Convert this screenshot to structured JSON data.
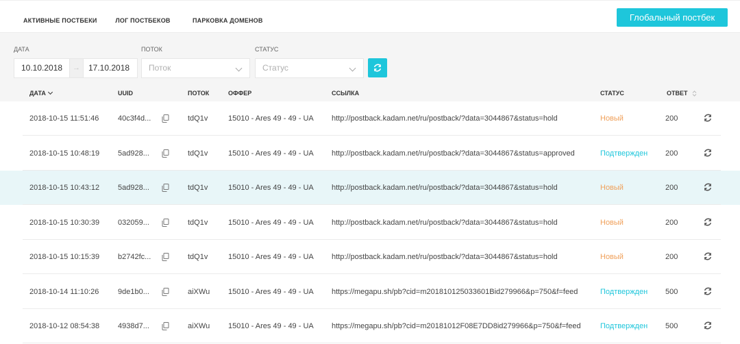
{
  "tabs": [
    {
      "label": "АКТИВНЫЕ ПОСТБЕКИ"
    },
    {
      "label": "ЛОГ ПОСТБЕКОВ"
    },
    {
      "label": "ПАРКОВКА ДОМЕНОВ"
    }
  ],
  "global_button": "Глобальный постбек",
  "filters": {
    "date_label": "ДАТА",
    "date_from": "10.10.2018",
    "date_to": "17.10.2018",
    "date_arrow": "→",
    "flow_label": "ПОТОК",
    "flow_placeholder": "Поток",
    "status_label": "СТАТУС",
    "status_placeholder": "Статус"
  },
  "table": {
    "headers": {
      "date": "ДАТА",
      "uuid": "UUID",
      "flow": "ПОТОК",
      "offer": "ОФФЕР",
      "link": "ССЫЛКА",
      "status": "СТАТУС",
      "answer": "ОТВЕТ"
    },
    "rows": [
      {
        "date": "2018-10-15 11:51:46",
        "uuid": "40c3f4d...",
        "flow": "tdQ1v",
        "offer": "15010 - Ares 49 - 49 - UA",
        "link": "http://postback.kadam.net/ru/postback/?data=3044867&status=hold",
        "status": "Новый",
        "answer": "200"
      },
      {
        "date": "2018-10-15 10:48:19",
        "uuid": "5ad928...",
        "flow": "tdQ1v",
        "offer": "15010 - Ares 49 - 49 - UA",
        "link": "http://postback.kadam.net/ru/postback/?data=3044867&status=approved",
        "status": "Подтвержден",
        "answer": "200"
      },
      {
        "date": "2018-10-15 10:43:12",
        "uuid": "5ad928...",
        "flow": "tdQ1v",
        "offer": "15010 - Ares 49 - 49 - UA",
        "link": "http://postback.kadam.net/ru/postback/?data=3044867&status=hold",
        "status": "Новый",
        "answer": "200"
      },
      {
        "date": "2018-10-15 10:30:39",
        "uuid": "032059...",
        "flow": "tdQ1v",
        "offer": "15010 - Ares 49 - 49 - UA",
        "link": "http://postback.kadam.net/ru/postback/?data=3044867&status=hold",
        "status": "Новый",
        "answer": "200"
      },
      {
        "date": "2018-10-15 10:15:39",
        "uuid": "b2742fc...",
        "flow": "tdQ1v",
        "offer": "15010 - Ares 49 - 49 - UA",
        "link": "http://postback.kadam.net/ru/postback/?data=3044867&status=hold",
        "status": "Новый",
        "answer": "200"
      },
      {
        "date": "2018-10-14 11:10:26",
        "uuid": "9de1b0...",
        "flow": "aiXWu",
        "offer": "15010 - Ares 49 - 49 - UA",
        "link": "https://megapu.sh/pb?cid=m201810125033601Bid279966&p=750&f=feed",
        "status": "Подтвержден",
        "answer": "500"
      },
      {
        "date": "2018-10-12 08:54:38",
        "uuid": "4938d7...",
        "flow": "aiXWu",
        "offer": "15010 - Ares 49 - 49 - UA",
        "link": "https://megapu.sh/pb?cid=m20181012F08E7DD8id279966&p=750&f=feed",
        "status": "Подтвержден",
        "answer": "500"
      }
    ]
  },
  "colors": {
    "accent": "#1ec6db",
    "tab_underline": "#e0574f",
    "status_new": "#f0a05a",
    "status_approved": "#1ec6db",
    "highlight_row": "#e8f6f8"
  },
  "icons": {
    "copy": "copy-icon",
    "refresh": "refresh-icon",
    "resend": "resend-icon",
    "chevron": "chevron-down-icon"
  }
}
